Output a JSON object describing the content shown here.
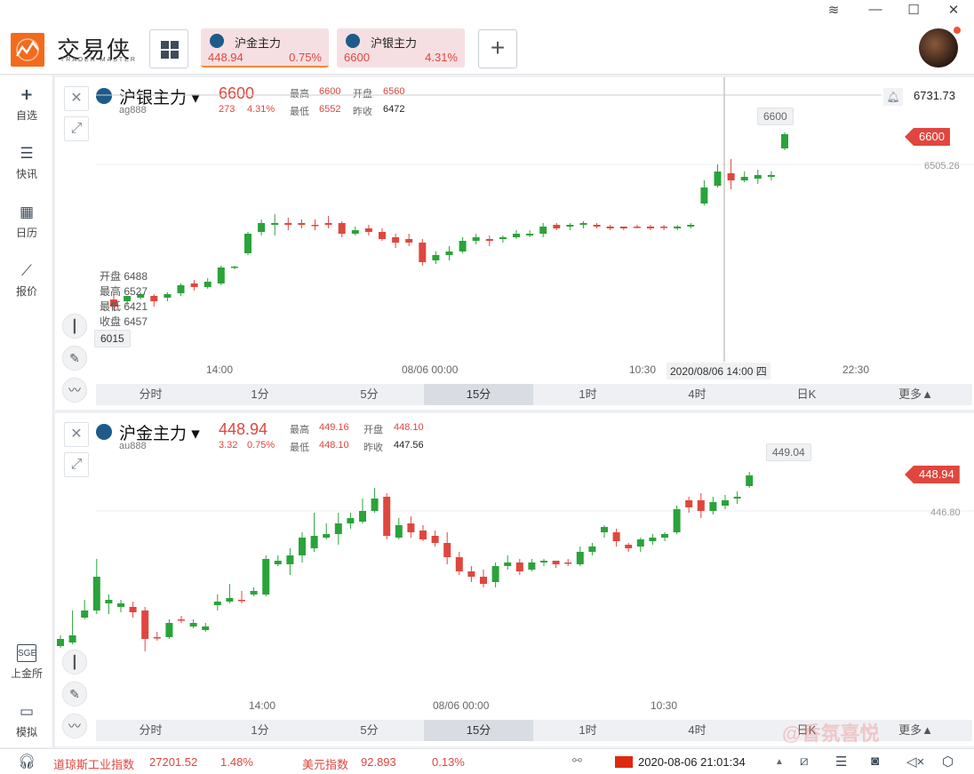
{
  "app": {
    "brand": "交易侠",
    "brand_sub": "TRADER MASTER",
    "tabs": [
      {
        "name": "沪金主力",
        "price": "448.94",
        "change": "0.75%",
        "icon": "gold-icon"
      },
      {
        "name": "沪银主力",
        "price": "6600",
        "change": "4.31%",
        "icon": "silver-icon"
      }
    ],
    "add_tab": "+"
  },
  "sidebar": {
    "items": [
      {
        "label": "自选",
        "icon": "bookmark-plus-icon"
      },
      {
        "label": "快讯",
        "icon": "news-list-icon"
      },
      {
        "label": "日历",
        "icon": "calendar-icon"
      },
      {
        "label": "报价",
        "icon": "trend-line-icon"
      },
      {
        "label": "上金所",
        "icon": "sge-icon"
      },
      {
        "label": "模拟",
        "icon": "wallet-icon"
      }
    ],
    "sge_logo": "SGE"
  },
  "top_chart": {
    "name": "沪银主力",
    "code": "ag888",
    "price": "6600",
    "change": "273",
    "change_pct": "4.31%",
    "high_label": "最高",
    "high": "6600",
    "open_label": "开盘",
    "open": "6560",
    "low_label": "最低",
    "low": "6552",
    "prev_label": "昨收",
    "prev": "6472",
    "crosshair_price": "6731.73",
    "last_tag": "6600",
    "bubble_top": "6600",
    "ref_level": "6505.26",
    "left_cross_price": "6015",
    "ohlc_open": "开盘 6488",
    "ohlc_high": "最高 6527",
    "ohlc_low": "最低 6421",
    "ohlc_close": "收盘 6457",
    "x_labels": [
      "14:00",
      "08/06 00:00",
      "10:30",
      "22:30"
    ],
    "crosshair_time": "2020/08/06 14:00 四"
  },
  "bottom_chart": {
    "name": "沪金主力",
    "code": "au888",
    "price": "448.94",
    "change": "3.32",
    "change_pct": "0.75%",
    "high_label": "最高",
    "high": "449.16",
    "open_label": "开盘",
    "open": "448.10",
    "low_label": "最低",
    "low": "448.10",
    "prev_label": "昨收",
    "prev": "447.56",
    "last_tag": "448.94",
    "bubble_top": "449.04",
    "ref_level": "446.80",
    "x_labels": [
      "14:00",
      "08/06 00:00",
      "10:30"
    ]
  },
  "periods": [
    "分时",
    "1分",
    "5分",
    "15分",
    "1时",
    "4时",
    "日K",
    "更多▲"
  ],
  "selected_period": "15分",
  "status": {
    "dow_label": "道琼斯工业指数",
    "dow_value": "27201.52",
    "dow_change": "1.48%",
    "usd_label": "美元指数",
    "usd_value": "92.893",
    "usd_change": "0.13%",
    "datetime": "2020-08-06 21:01:34"
  },
  "watermark": "@香氛喜悦",
  "colors": {
    "up": "#e0463e",
    "down": "#2aa33a",
    "accent": "#f26b1d"
  }
}
